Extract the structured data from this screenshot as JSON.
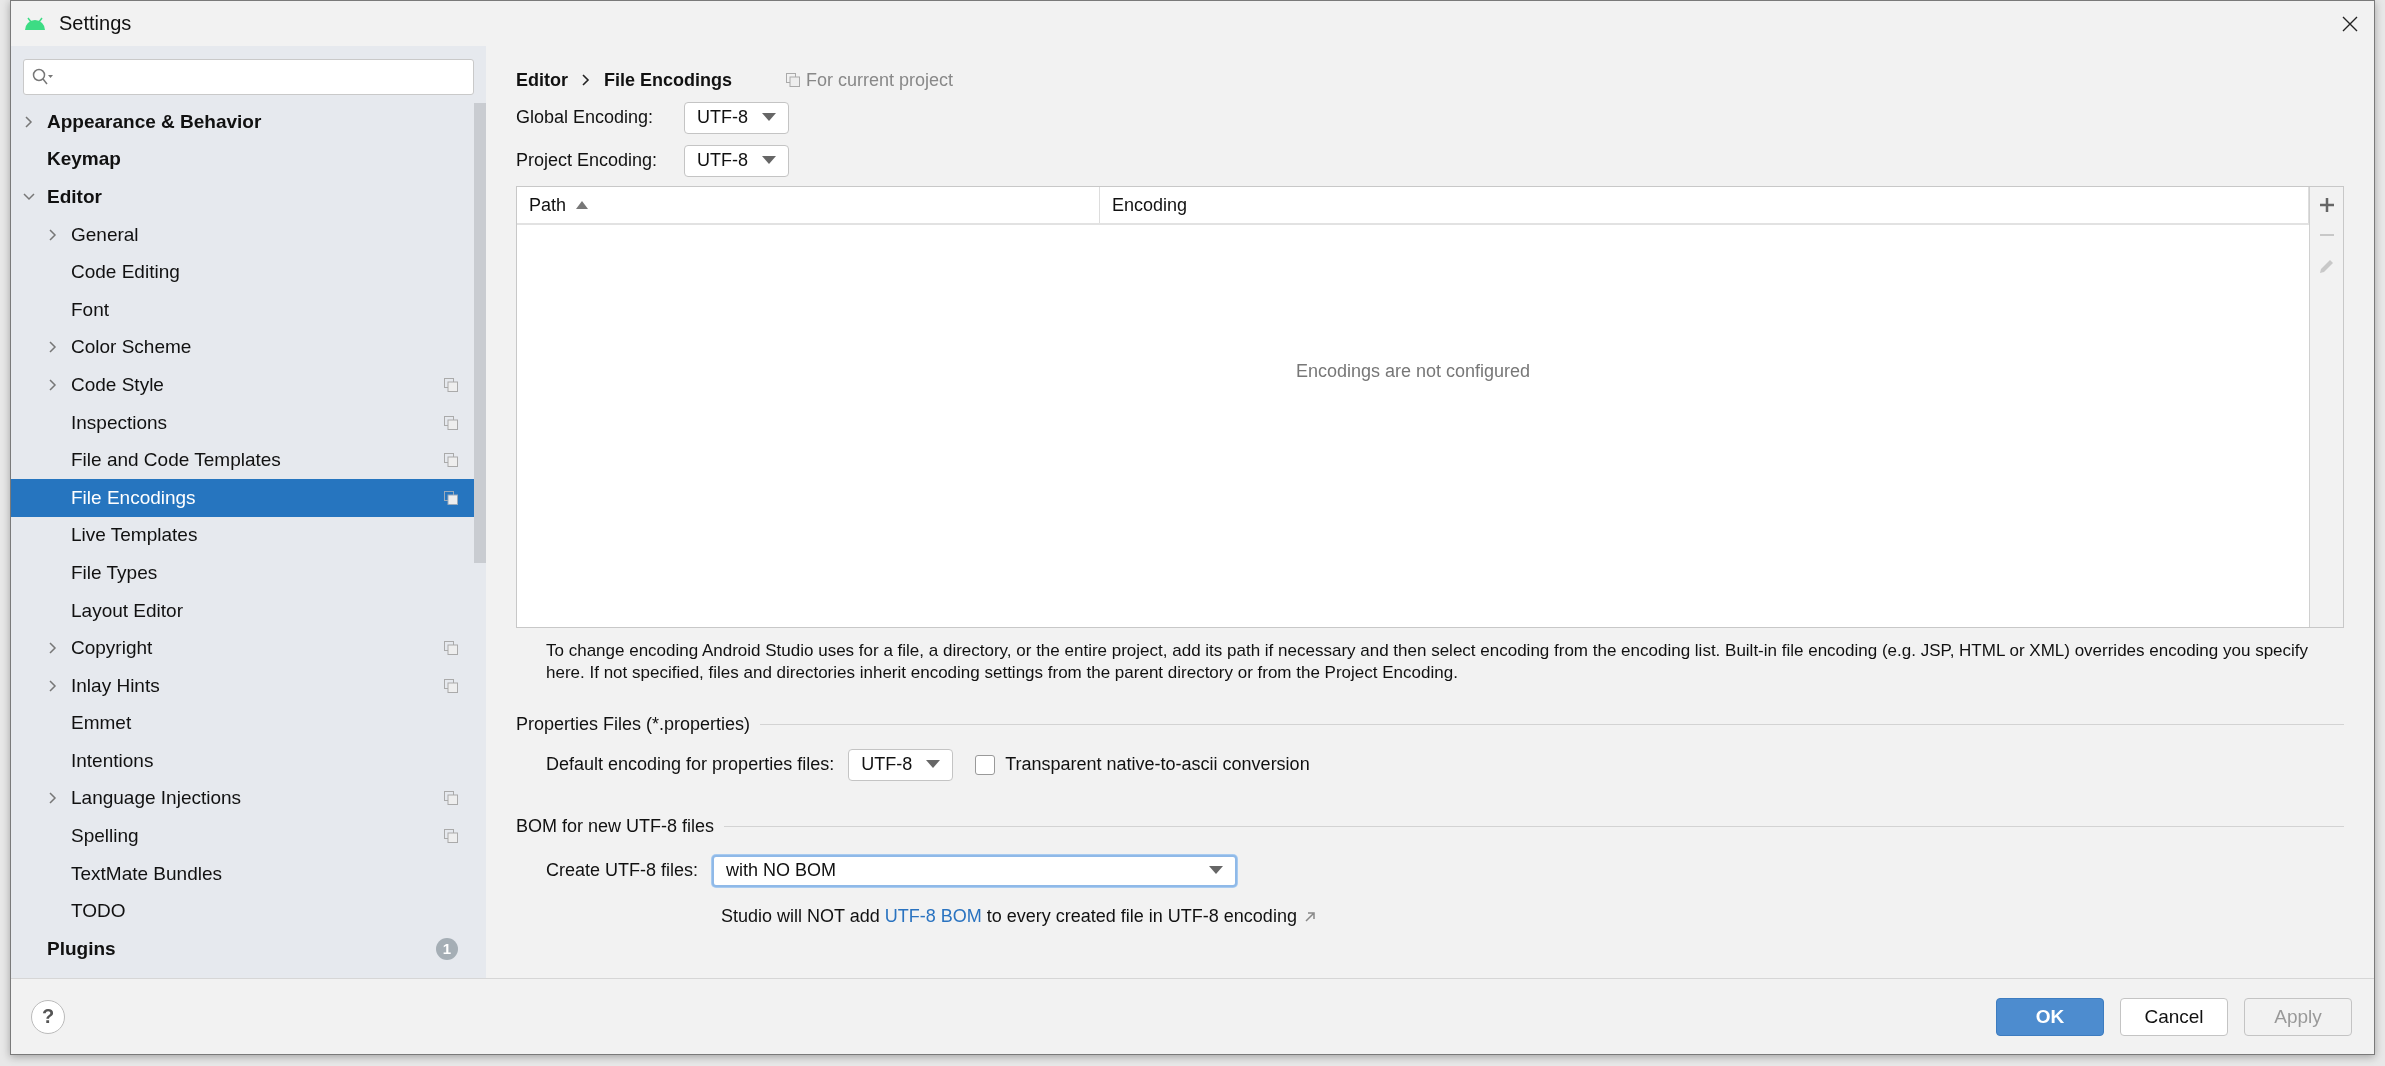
{
  "window": {
    "title": "Settings"
  },
  "sidebar": {
    "items": [
      {
        "label": "Appearance & Behavior",
        "kind": "branch",
        "expanded": false,
        "selected": false,
        "per_project": false
      },
      {
        "label": "Keymap",
        "kind": "leaf",
        "selected": false,
        "per_project": false
      },
      {
        "label": "Editor",
        "kind": "branch",
        "expanded": true,
        "selected": false,
        "per_project": false,
        "children": [
          {
            "label": "General",
            "kind": "branch",
            "expanded": false,
            "selected": false,
            "per_project": false
          },
          {
            "label": "Code Editing",
            "kind": "leaf",
            "selected": false,
            "per_project": false
          },
          {
            "label": "Font",
            "kind": "leaf",
            "selected": false,
            "per_project": false
          },
          {
            "label": "Color Scheme",
            "kind": "branch",
            "expanded": false,
            "selected": false,
            "per_project": false
          },
          {
            "label": "Code Style",
            "kind": "branch",
            "expanded": false,
            "selected": false,
            "per_project": true
          },
          {
            "label": "Inspections",
            "kind": "leaf",
            "selected": false,
            "per_project": true
          },
          {
            "label": "File and Code Templates",
            "kind": "leaf",
            "selected": false,
            "per_project": true
          },
          {
            "label": "File Encodings",
            "kind": "leaf",
            "selected": true,
            "per_project": true
          },
          {
            "label": "Live Templates",
            "kind": "leaf",
            "selected": false,
            "per_project": false
          },
          {
            "label": "File Types",
            "kind": "leaf",
            "selected": false,
            "per_project": false
          },
          {
            "label": "Layout Editor",
            "kind": "leaf",
            "selected": false,
            "per_project": false
          },
          {
            "label": "Copyright",
            "kind": "branch",
            "expanded": false,
            "selected": false,
            "per_project": true
          },
          {
            "label": "Inlay Hints",
            "kind": "branch",
            "expanded": false,
            "selected": false,
            "per_project": true
          },
          {
            "label": "Emmet",
            "kind": "leaf",
            "selected": false,
            "per_project": false
          },
          {
            "label": "Intentions",
            "kind": "leaf",
            "selected": false,
            "per_project": false
          },
          {
            "label": "Language Injections",
            "kind": "branch",
            "expanded": false,
            "selected": false,
            "per_project": true
          },
          {
            "label": "Spelling",
            "kind": "leaf",
            "selected": false,
            "per_project": true
          },
          {
            "label": "TextMate Bundles",
            "kind": "leaf",
            "selected": false,
            "per_project": false
          },
          {
            "label": "TODO",
            "kind": "leaf",
            "selected": false,
            "per_project": false
          }
        ]
      },
      {
        "label": "Plugins",
        "kind": "leaf",
        "selected": false,
        "per_project": false,
        "badge": "1"
      }
    ]
  },
  "breadcrumb": [
    "Editor",
    "File Encodings"
  ],
  "scope_note": "For current project",
  "encodings": [
    {
      "label": "Global Encoding:",
      "value": "UTF-8"
    },
    {
      "label": "Project Encoding:",
      "value": "UTF-8"
    }
  ],
  "table": {
    "columns": [
      "Path",
      "Encoding"
    ],
    "empty_text": "Encodings are not configured",
    "toolbar": [
      {
        "kind": "add",
        "disabled": false
      },
      {
        "kind": "remove",
        "disabled": true
      },
      {
        "kind": "edit",
        "disabled": true
      }
    ]
  },
  "help_text": "To change encoding Android Studio uses for a file, a directory, or the entire project, add its path if necessary and then select encoding from the encoding list. Built-in file encoding (e.g. JSP, HTML or XML) overrides encoding you specify here. If not specified, files and directories inherit encoding settings from the parent directory or from the Project Encoding.",
  "properties": {
    "title": "Properties Files (*.properties)",
    "label": "Default encoding for properties files:",
    "value": "UTF-8",
    "checkbox": {
      "label": "Transparent native-to-ascii conversion",
      "checked": false
    }
  },
  "bom": {
    "title": "BOM for new UTF-8 files",
    "label": "Create UTF-8 files:",
    "value": "with NO BOM",
    "note_before": "Studio will NOT add ",
    "note_link": "UTF-8 BOM",
    "note_after": " to every created file in UTF-8 encoding"
  },
  "help_button": "?",
  "buttons": [
    {
      "label": "OK",
      "kind": "primary",
      "disabled": false
    },
    {
      "label": "Cancel",
      "kind": "normal",
      "disabled": false
    },
    {
      "label": "Apply",
      "kind": "normal",
      "disabled": true
    }
  ]
}
